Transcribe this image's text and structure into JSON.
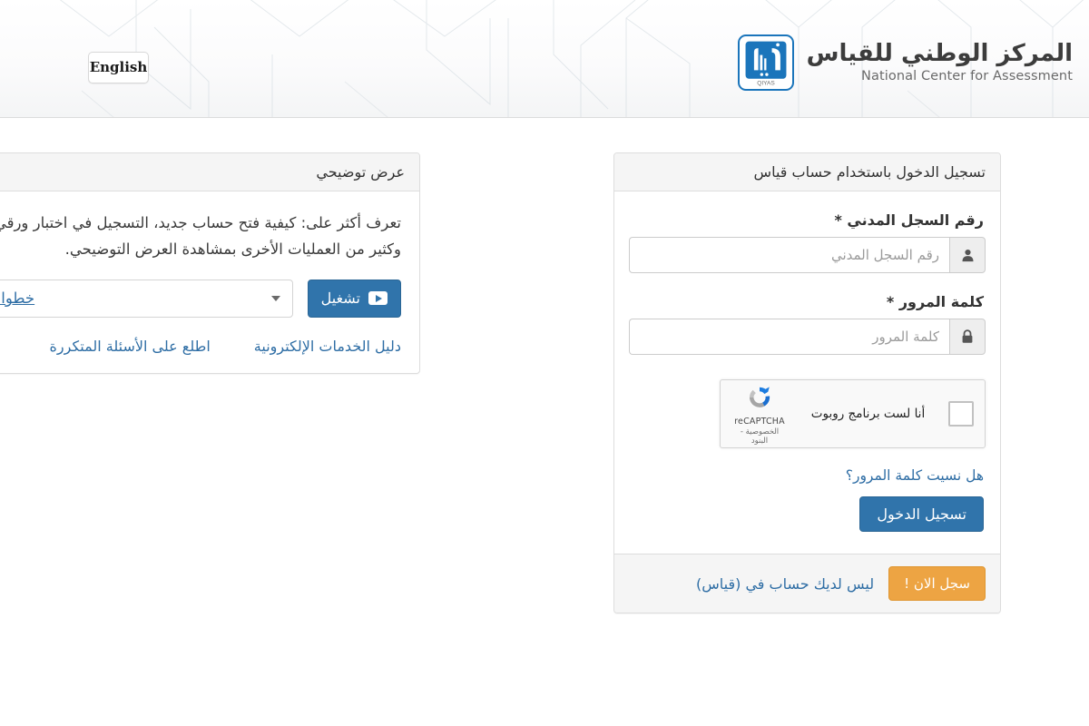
{
  "header": {
    "lang_button": "English",
    "brand_ar": "المركز الوطني للقياس",
    "brand_en": "National Center for Assessment",
    "logo_caption": "QIYAS"
  },
  "demo_panel": {
    "heading": "عرض توضيحي",
    "description": "تعرف أكثر على: كيفية فتح حساب جديد، التسجيل في اختبار ورقي أو محوسب، وكثير من العمليات الأخرى بمشاهدة العرض التوضيحي.",
    "select_value": "خطوات فتح ملف جديد",
    "select_options": [
      "خطوات فتح ملف جديد"
    ],
    "play_button": "تشغيل",
    "links": [
      {
        "label": "اطلع على الأسئلة المتكررة"
      },
      {
        "label": "دليل الخدمات الإلكترونية"
      }
    ]
  },
  "login_panel": {
    "heading": "تسجيل الدخول باستخدام حساب قياس",
    "civil_id": {
      "label": "رقم السجل المدني *",
      "placeholder": "رقم السجل المدني",
      "value": ""
    },
    "password": {
      "label": "كلمة المرور *",
      "placeholder": "كلمة المرور",
      "value": ""
    },
    "recaptcha": {
      "checkbox_label": "أنا لست برنامج روبوت",
      "brand": "reCAPTCHA",
      "terms": "الخصوصية - البنود",
      "checked": false
    },
    "forgot_link": "هل نسيت كلمة المرور؟",
    "submit_button": "تسجيل الدخول",
    "footer_text": "ليس لديك حساب في (قياس)",
    "register_button": "سجل الان !"
  },
  "colors": {
    "primary_blue": "#3074ab",
    "brand_blue": "#1b75bb",
    "link_blue": "#2f6ea5",
    "accent_orange": "#eda443",
    "panel_grey": "#f5f5f5",
    "border_grey": "#dddddd"
  }
}
